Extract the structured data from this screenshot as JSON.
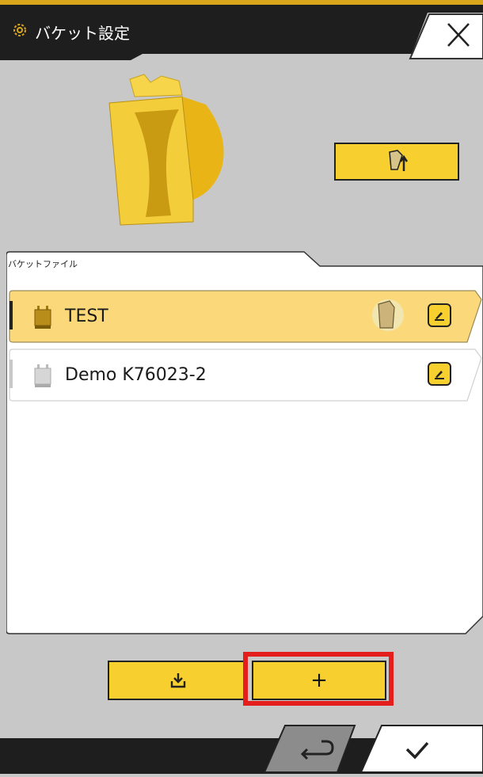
{
  "header": {
    "title": "バケット設定",
    "gear_icon": "gear-icon",
    "close_icon": "close-icon"
  },
  "bucket_preview": {
    "image": "bucket-3d-image",
    "swap_icon": "bucket-swap-icon"
  },
  "file_panel": {
    "label": "バケットファイル",
    "items": [
      {
        "name": "TEST",
        "selected": true,
        "chip_icon": "bucket-chip-icon",
        "active_icon": "bucket-in-use-icon",
        "edit_icon": "edit-icon"
      },
      {
        "name": "Demo K76023-2",
        "selected": false,
        "chip_icon": "bucket-chip-icon",
        "edit_icon": "edit-icon"
      }
    ]
  },
  "actions": {
    "download_icon": "download-icon",
    "add_label": "+"
  },
  "footer": {
    "back_icon": "return-icon",
    "ok_icon": "checkmark-icon"
  },
  "colors": {
    "accent": "#f7d02f",
    "selected_row": "#fbd97a",
    "header": "#1e1e1e",
    "highlight": "#e41d1d"
  }
}
